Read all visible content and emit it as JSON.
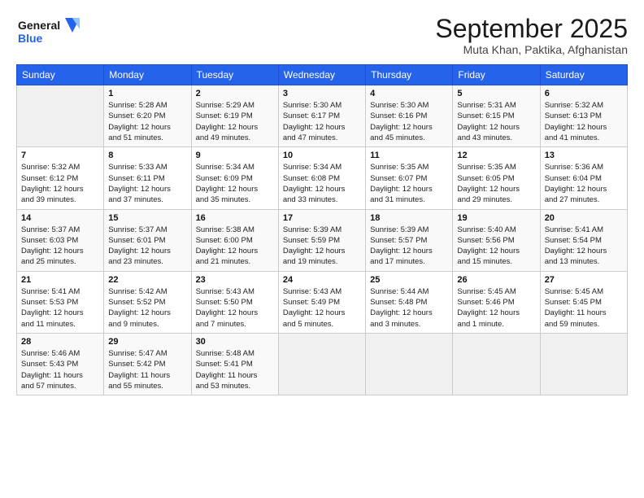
{
  "header": {
    "logo_line1": "General",
    "logo_line2": "Blue",
    "title": "September 2025",
    "subtitle": "Muta Khan, Paktika, Afghanistan"
  },
  "weekdays": [
    "Sunday",
    "Monday",
    "Tuesday",
    "Wednesday",
    "Thursday",
    "Friday",
    "Saturday"
  ],
  "weeks": [
    [
      {
        "day": "",
        "info": ""
      },
      {
        "day": "1",
        "info": "Sunrise: 5:28 AM\nSunset: 6:20 PM\nDaylight: 12 hours\nand 51 minutes."
      },
      {
        "day": "2",
        "info": "Sunrise: 5:29 AM\nSunset: 6:19 PM\nDaylight: 12 hours\nand 49 minutes."
      },
      {
        "day": "3",
        "info": "Sunrise: 5:30 AM\nSunset: 6:17 PM\nDaylight: 12 hours\nand 47 minutes."
      },
      {
        "day": "4",
        "info": "Sunrise: 5:30 AM\nSunset: 6:16 PM\nDaylight: 12 hours\nand 45 minutes."
      },
      {
        "day": "5",
        "info": "Sunrise: 5:31 AM\nSunset: 6:15 PM\nDaylight: 12 hours\nand 43 minutes."
      },
      {
        "day": "6",
        "info": "Sunrise: 5:32 AM\nSunset: 6:13 PM\nDaylight: 12 hours\nand 41 minutes."
      }
    ],
    [
      {
        "day": "7",
        "info": "Sunrise: 5:32 AM\nSunset: 6:12 PM\nDaylight: 12 hours\nand 39 minutes."
      },
      {
        "day": "8",
        "info": "Sunrise: 5:33 AM\nSunset: 6:11 PM\nDaylight: 12 hours\nand 37 minutes."
      },
      {
        "day": "9",
        "info": "Sunrise: 5:34 AM\nSunset: 6:09 PM\nDaylight: 12 hours\nand 35 minutes."
      },
      {
        "day": "10",
        "info": "Sunrise: 5:34 AM\nSunset: 6:08 PM\nDaylight: 12 hours\nand 33 minutes."
      },
      {
        "day": "11",
        "info": "Sunrise: 5:35 AM\nSunset: 6:07 PM\nDaylight: 12 hours\nand 31 minutes."
      },
      {
        "day": "12",
        "info": "Sunrise: 5:35 AM\nSunset: 6:05 PM\nDaylight: 12 hours\nand 29 minutes."
      },
      {
        "day": "13",
        "info": "Sunrise: 5:36 AM\nSunset: 6:04 PM\nDaylight: 12 hours\nand 27 minutes."
      }
    ],
    [
      {
        "day": "14",
        "info": "Sunrise: 5:37 AM\nSunset: 6:03 PM\nDaylight: 12 hours\nand 25 minutes."
      },
      {
        "day": "15",
        "info": "Sunrise: 5:37 AM\nSunset: 6:01 PM\nDaylight: 12 hours\nand 23 minutes."
      },
      {
        "day": "16",
        "info": "Sunrise: 5:38 AM\nSunset: 6:00 PM\nDaylight: 12 hours\nand 21 minutes."
      },
      {
        "day": "17",
        "info": "Sunrise: 5:39 AM\nSunset: 5:59 PM\nDaylight: 12 hours\nand 19 minutes."
      },
      {
        "day": "18",
        "info": "Sunrise: 5:39 AM\nSunset: 5:57 PM\nDaylight: 12 hours\nand 17 minutes."
      },
      {
        "day": "19",
        "info": "Sunrise: 5:40 AM\nSunset: 5:56 PM\nDaylight: 12 hours\nand 15 minutes."
      },
      {
        "day": "20",
        "info": "Sunrise: 5:41 AM\nSunset: 5:54 PM\nDaylight: 12 hours\nand 13 minutes."
      }
    ],
    [
      {
        "day": "21",
        "info": "Sunrise: 5:41 AM\nSunset: 5:53 PM\nDaylight: 12 hours\nand 11 minutes."
      },
      {
        "day": "22",
        "info": "Sunrise: 5:42 AM\nSunset: 5:52 PM\nDaylight: 12 hours\nand 9 minutes."
      },
      {
        "day": "23",
        "info": "Sunrise: 5:43 AM\nSunset: 5:50 PM\nDaylight: 12 hours\nand 7 minutes."
      },
      {
        "day": "24",
        "info": "Sunrise: 5:43 AM\nSunset: 5:49 PM\nDaylight: 12 hours\nand 5 minutes."
      },
      {
        "day": "25",
        "info": "Sunrise: 5:44 AM\nSunset: 5:48 PM\nDaylight: 12 hours\nand 3 minutes."
      },
      {
        "day": "26",
        "info": "Sunrise: 5:45 AM\nSunset: 5:46 PM\nDaylight: 12 hours\nand 1 minute."
      },
      {
        "day": "27",
        "info": "Sunrise: 5:45 AM\nSunset: 5:45 PM\nDaylight: 11 hours\nand 59 minutes."
      }
    ],
    [
      {
        "day": "28",
        "info": "Sunrise: 5:46 AM\nSunset: 5:43 PM\nDaylight: 11 hours\nand 57 minutes."
      },
      {
        "day": "29",
        "info": "Sunrise: 5:47 AM\nSunset: 5:42 PM\nDaylight: 11 hours\nand 55 minutes."
      },
      {
        "day": "30",
        "info": "Sunrise: 5:48 AM\nSunset: 5:41 PM\nDaylight: 11 hours\nand 53 minutes."
      },
      {
        "day": "",
        "info": ""
      },
      {
        "day": "",
        "info": ""
      },
      {
        "day": "",
        "info": ""
      },
      {
        "day": "",
        "info": ""
      }
    ]
  ]
}
